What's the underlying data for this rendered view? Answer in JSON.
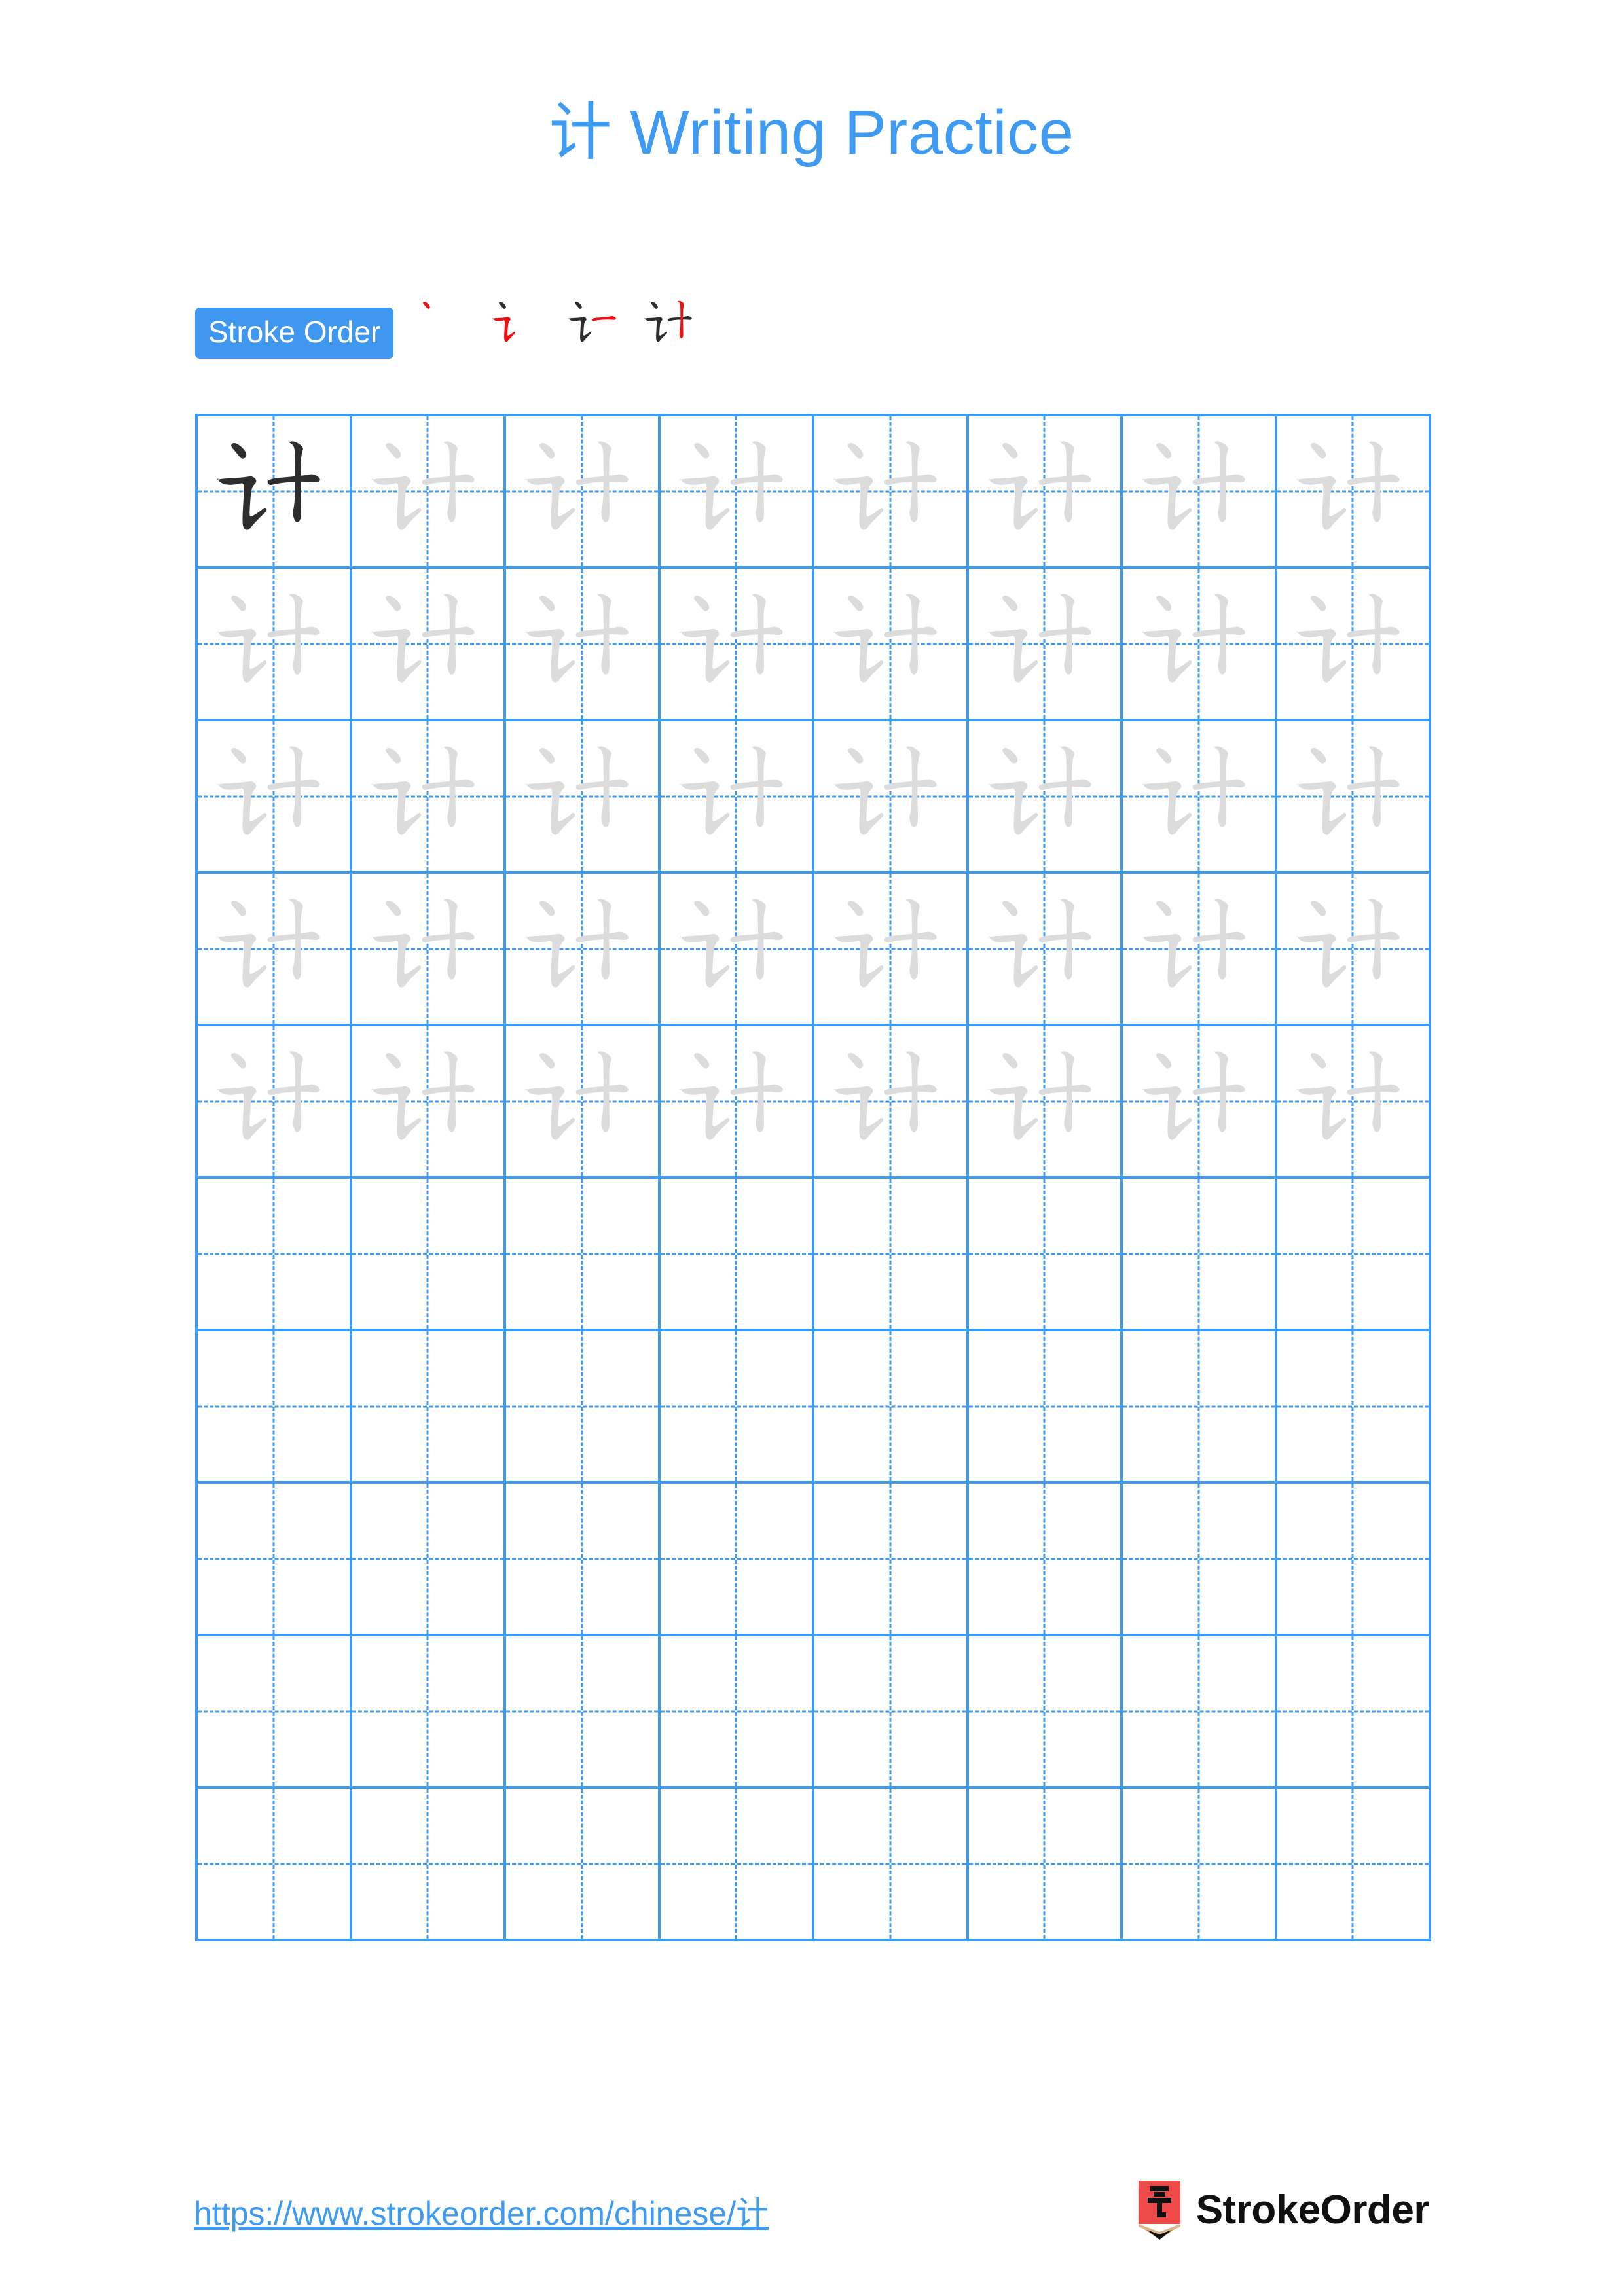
{
  "page": {
    "title_char": "计",
    "title_suffix": " Writing Practice",
    "title_full": "计 Writing Practice",
    "accent_color": "#3f9bf2",
    "badge_color": "#3f97f0",
    "new_stroke_color": "#ee1111",
    "done_stroke_color": "#2d2d2d",
    "trace_stroke_color": "#dcdcdc",
    "model_stroke_color": "#2d2d2d",
    "background_color": "#ffffff"
  },
  "stroke_order": {
    "badge_label": "Stroke Order",
    "character": "计",
    "total_strokes": 4,
    "steps": [
      {
        "index": 1,
        "name": "dian",
        "new_stroke": 1
      },
      {
        "index": 2,
        "name": "hengzhezhe",
        "new_stroke": 2
      },
      {
        "index": 3,
        "name": "heng",
        "new_stroke": 3
      },
      {
        "index": 4,
        "name": "shu",
        "new_stroke": 4
      }
    ]
  },
  "grid": {
    "columns": 8,
    "rows": 10,
    "filled_rows": 5,
    "empty_rows": 5,
    "model_cell": {
      "row": 1,
      "column": 1
    },
    "guides": "crosshair-dashed"
  },
  "footer": {
    "url": "https://www.strokeorder.com/chinese/计",
    "brand_name": "StrokeOrder",
    "logo_name": "pencil-logo",
    "logo_char": "字",
    "logo_body_color": "#ef4a4a",
    "logo_wood_color": "#dcb58c",
    "logo_tip_color": "#111111"
  }
}
